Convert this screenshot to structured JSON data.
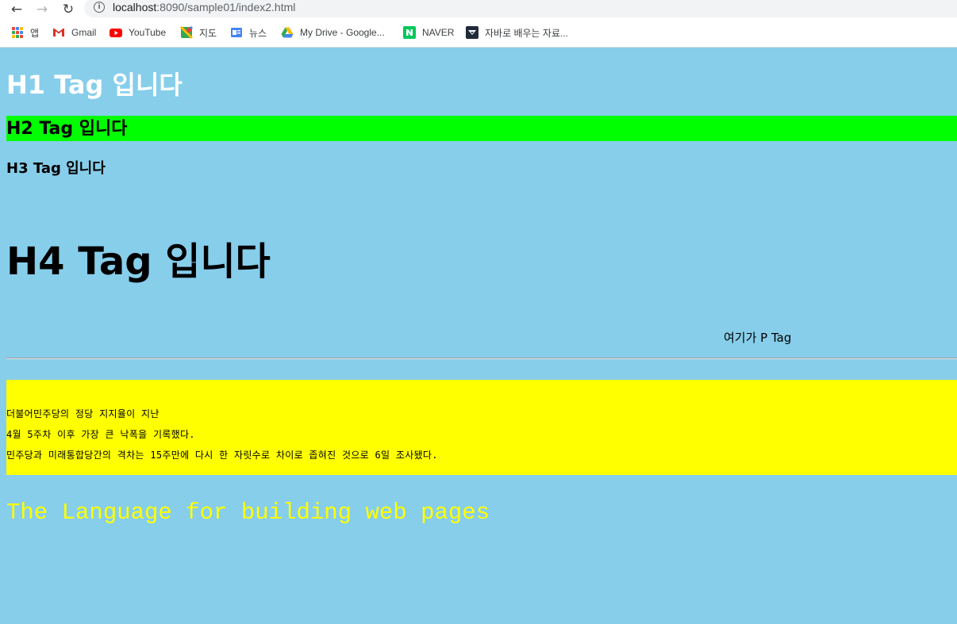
{
  "browser": {
    "url_host": "localhost",
    "url_rest": ":8090/sample01/index2.html"
  },
  "bookmarks": [
    {
      "label": "앱",
      "icon": "apps-grid-icon"
    },
    {
      "label": "Gmail",
      "icon": "gmail-icon"
    },
    {
      "label": "YouTube",
      "icon": "youtube-icon"
    },
    {
      "label": "지도",
      "icon": "maps-icon"
    },
    {
      "label": "뉴스",
      "icon": "news-icon"
    },
    {
      "label": "My Drive - Google...",
      "icon": "drive-icon"
    },
    {
      "label": "NAVER",
      "icon": "naver-icon"
    },
    {
      "label": "자바로 배우는 자료...",
      "icon": "java-icon"
    }
  ],
  "page": {
    "h1": "H1 Tag 입니다",
    "h2": "H2 Tag 입니다",
    "h3": "H3 Tag 입니다",
    "h4": "H4 Tag 입니다",
    "p": "여기가 P Tag",
    "pre_lines": [
      "더불어민주당의 정당 지지율이 지난",
      "4월 5주차 이후 가장 큰 낙폭을 기록했다.",
      "민주당과 미래통합당간의 격차는 15주만에 다시 한 자릿수로 차이로 좁혀진 것으로 6일 조사됐다."
    ],
    "mono_text": "The Language for building web pages"
  },
  "colors": {
    "page_background": "#87ceeb",
    "h2_background": "#00ff00",
    "pre_background": "#ffff00",
    "mono_text_color": "#ffff00",
    "h1_color": "#ffffff"
  }
}
